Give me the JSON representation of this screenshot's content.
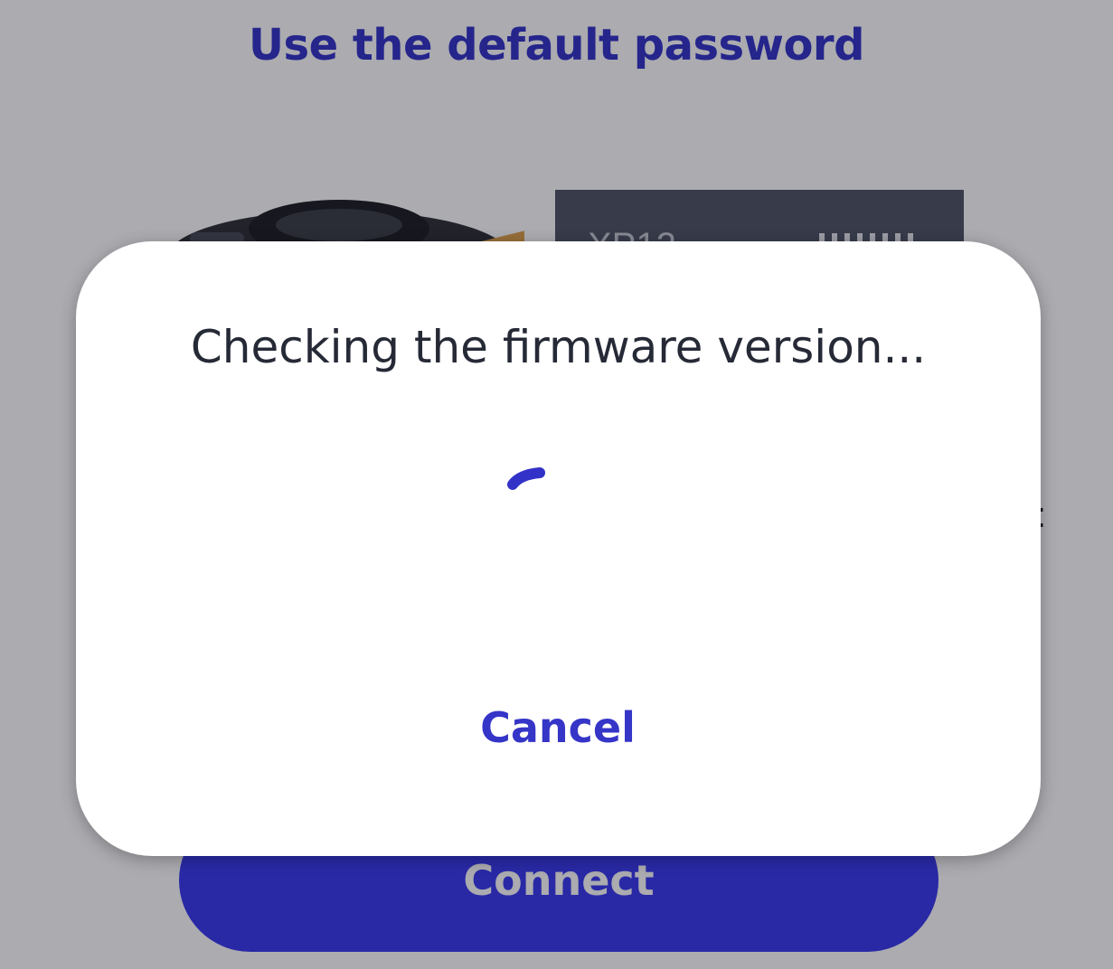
{
  "app": {
    "page_title": "Use the default password",
    "device_card_label": "XP12",
    "connect_label": "Connect"
  },
  "dialog": {
    "message": "Checking the firmware version...",
    "cancel_label": "Cancel"
  },
  "colors": {
    "accent": "#3535c8",
    "button_fill": "#3a3af0",
    "dialog_text": "#262a36",
    "scrim": "#0a0a18"
  },
  "icons": {
    "camera": "camera-icon",
    "spinner": "loading-spinner-icon"
  }
}
